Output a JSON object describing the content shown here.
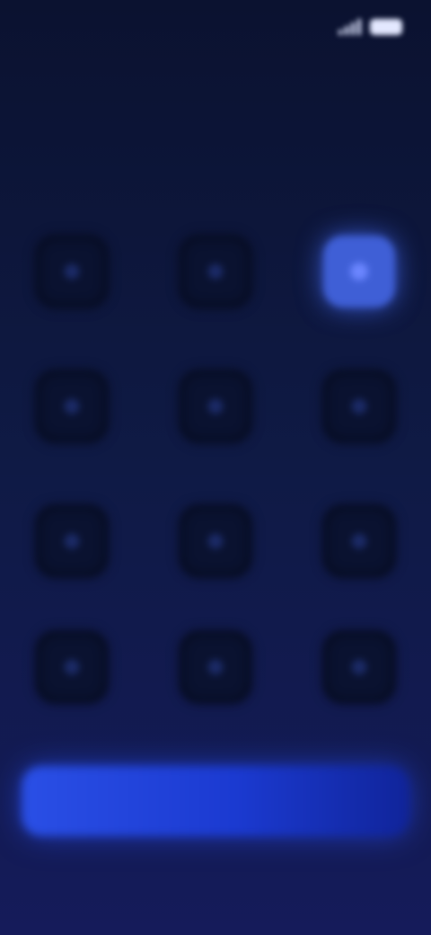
{
  "status_bar": {
    "time": "",
    "time_icon": "clock-text",
    "signal_icon": "signal-icon",
    "battery_icon": "battery-icon"
  },
  "title": "",
  "grid": {
    "tiles": [
      {
        "icon": "generic-icon-1",
        "label": "",
        "selected": false
      },
      {
        "icon": "generic-icon-2",
        "label": "",
        "selected": false
      },
      {
        "icon": "generic-icon-3",
        "label": "",
        "selected": true
      },
      {
        "icon": "generic-icon-4",
        "label": "",
        "selected": false
      },
      {
        "icon": "generic-icon-5",
        "label": "",
        "selected": false
      },
      {
        "icon": "generic-icon-6",
        "label": "",
        "selected": false
      },
      {
        "icon": "generic-icon-7",
        "label": "",
        "selected": false
      },
      {
        "icon": "generic-icon-8",
        "label": "",
        "selected": false
      },
      {
        "icon": "generic-icon-9",
        "label": "",
        "selected": false
      },
      {
        "icon": "generic-icon-10",
        "label": "",
        "selected": false
      },
      {
        "icon": "generic-icon-11",
        "label": "",
        "selected": false
      },
      {
        "icon": "generic-icon-12",
        "label": "",
        "selected": false
      }
    ]
  },
  "primary_button": {
    "label": ""
  },
  "colors": {
    "background_top": "#0b1230",
    "background_bottom": "#151b5a",
    "accent": "#3f5fd6",
    "button": "#2a4fe6"
  }
}
